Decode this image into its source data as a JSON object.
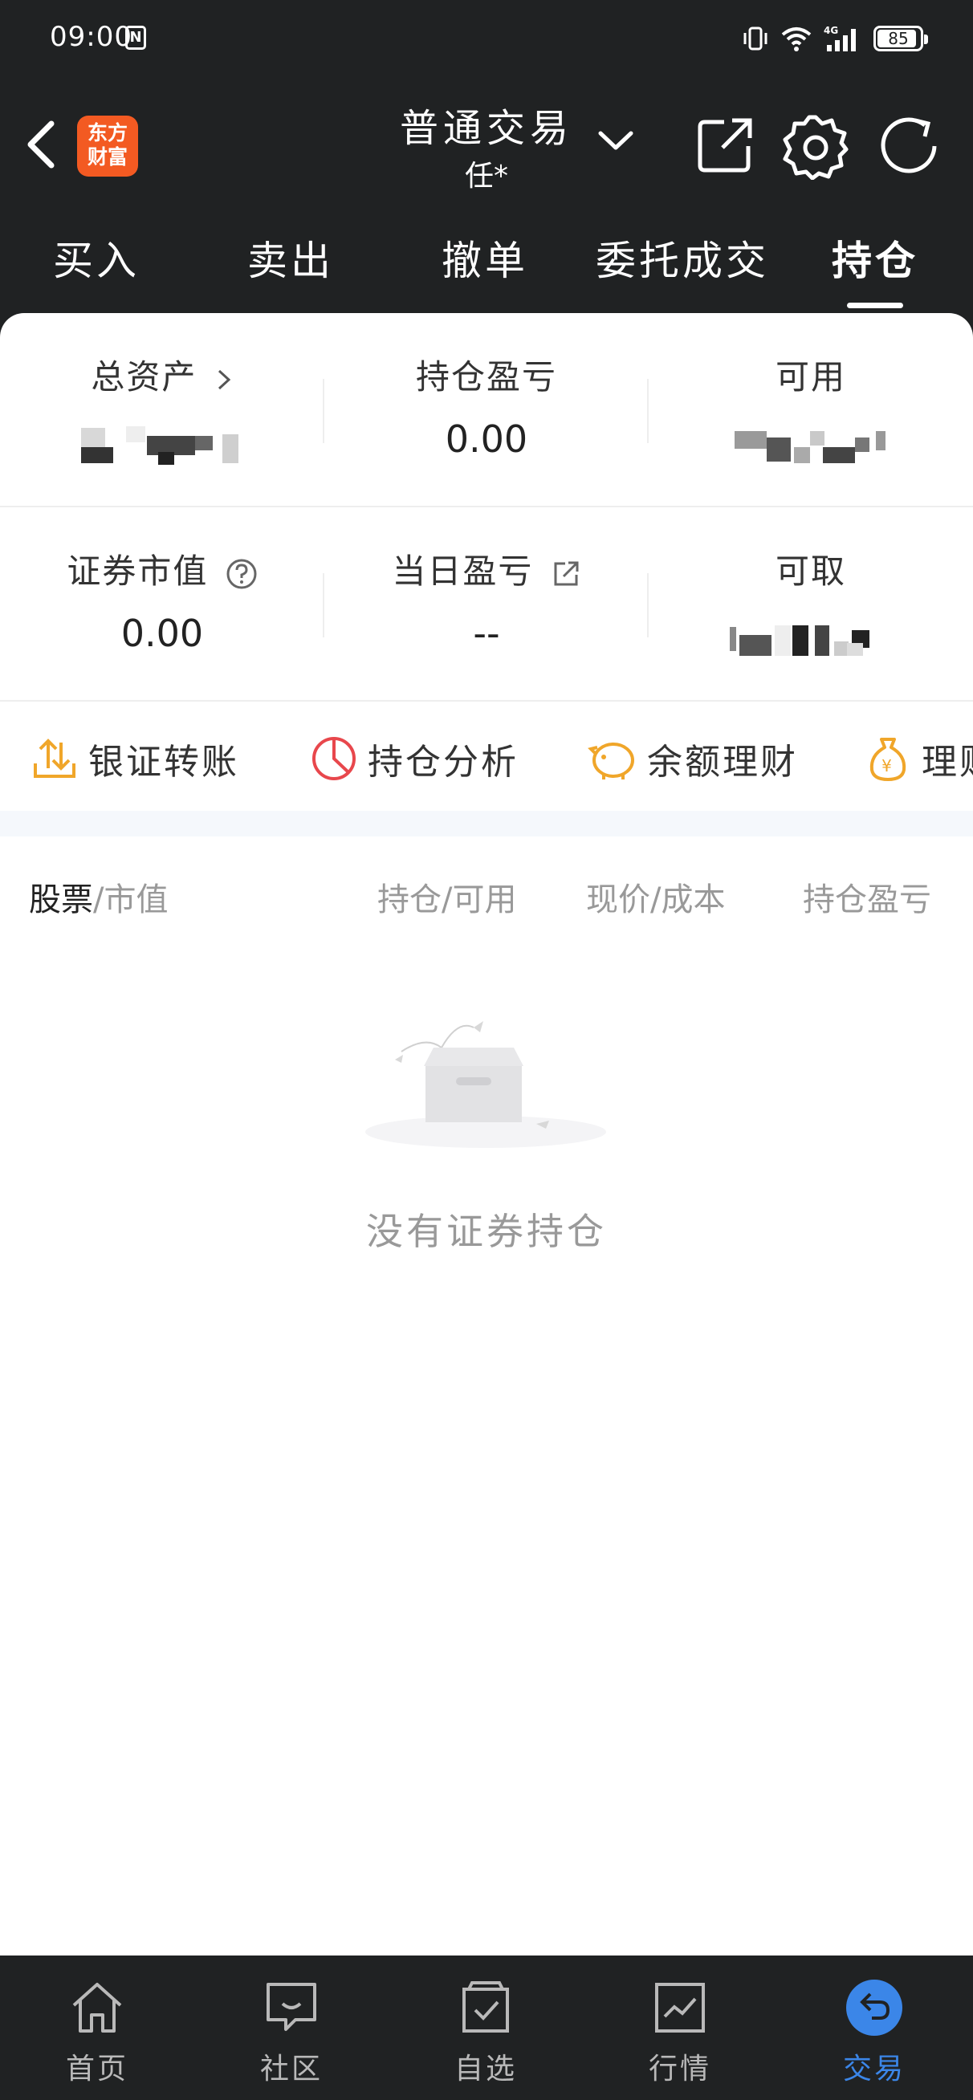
{
  "status_bar": {
    "time": "09:00",
    "battery": "85",
    "network": "4G"
  },
  "header": {
    "title": "普通交易",
    "subtitle": "任*",
    "brand_logo": {
      "line1": "东方",
      "line2": "财富",
      "color": "#f35a22"
    },
    "icons": [
      "back-icon",
      "chevron-down-icon",
      "share-icon",
      "gear-icon",
      "refresh-icon"
    ]
  },
  "tabs": [
    {
      "label": "买入"
    },
    {
      "label": "卖出"
    },
    {
      "label": "撤单"
    },
    {
      "label": "委托成交"
    },
    {
      "label": "持仓",
      "active": true
    }
  ],
  "summary": {
    "total_assets": {
      "label": "总资产",
      "value": "masked"
    },
    "position_pnl": {
      "label": "持仓盈亏",
      "value": "0.00"
    },
    "available": {
      "label": "可用",
      "value": "masked"
    },
    "market_value": {
      "label": "证券市值",
      "value": "0.00"
    },
    "daily_pnl": {
      "label": "当日盈亏",
      "value": "--"
    },
    "withdrawable": {
      "label": "可取",
      "value": "masked"
    }
  },
  "quick_actions": [
    {
      "label": "银证转账",
      "icon": "transfer-icon"
    },
    {
      "label": "持仓分析",
      "icon": "pie-chart-icon"
    },
    {
      "label": "余额理财",
      "icon": "piggy-bank-icon"
    },
    {
      "label": "理财",
      "icon": "money-bag-icon"
    }
  ],
  "table": {
    "col1_primary": "股票",
    "col1_secondary": "/市值",
    "col2": "持仓/可用",
    "col3": "现价/成本",
    "col4": "持仓盈亏"
  },
  "empty_state": {
    "text": "没有证券持仓",
    "icon": "empty-box-icon"
  },
  "bottom_nav": [
    {
      "label": "首页",
      "icon": "home-icon"
    },
    {
      "label": "社区",
      "icon": "chat-icon"
    },
    {
      "label": "自选",
      "icon": "watchlist-icon"
    },
    {
      "label": "行情",
      "icon": "chart-icon"
    },
    {
      "label": "交易",
      "icon": "trade-icon",
      "active": true
    }
  ],
  "colors": {
    "dark_bg": "#202223",
    "accent_blue": "#3b86e8",
    "brand_orange": "#f35a22",
    "analysis_red": "#e8474c",
    "action_orange": "#f0a62a"
  }
}
